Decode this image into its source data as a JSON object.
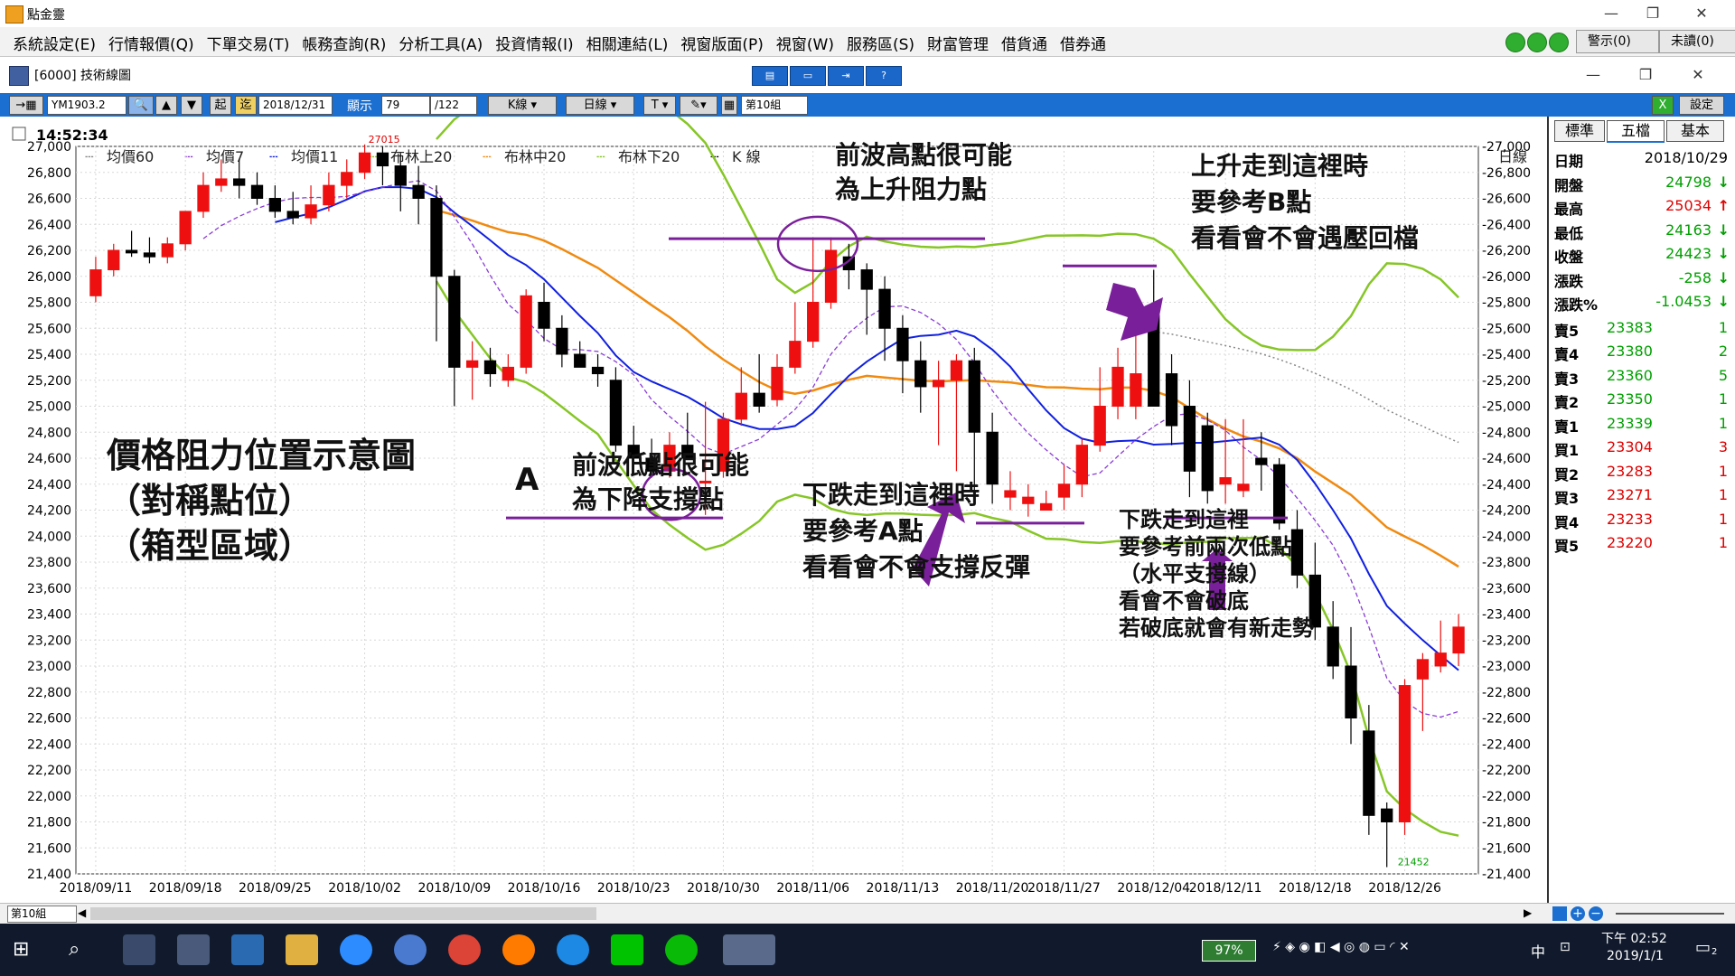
{
  "app": {
    "title": "點金靈",
    "window_controls": {
      "min": "—",
      "max": "❐",
      "close": "✕"
    }
  },
  "menu": {
    "items": [
      "系統設定(E)",
      "行情報價(Q)",
      "下單交易(T)",
      "帳務查詢(R)",
      "分析工具(A)",
      "投資情報(I)",
      "相關連結(L)",
      "視窗版面(P)",
      "視窗(W)",
      "服務區(S)",
      "財富管理",
      "借貨通",
      "借券通"
    ],
    "alert_button": "警示(0)",
    "unread_button": "未讀(0)"
  },
  "chart_window": {
    "title": "[6000] 技術線圖"
  },
  "toolbar": {
    "symbol": "YM1903.2",
    "start_btn": "起",
    "end_btn": "迄",
    "date": "2018/12/31",
    "display_label": "顯示",
    "display_count": "79",
    "total": "/122",
    "kline": "K線",
    "period": "日線",
    "text_tool": "T",
    "group": "第10組",
    "settings": "設定"
  },
  "time_display": "14:52:34",
  "legend": [
    {
      "label": "均價60",
      "color": "#888888"
    },
    {
      "label": "均價7",
      "color": "#8a3cd8"
    },
    {
      "label": "均價11",
      "color": "#1020e0"
    },
    {
      "label": "布林上20",
      "color": "#86c626"
    },
    {
      "label": "布林中20",
      "color": "#f08a10"
    },
    {
      "label": "布林下20",
      "color": "#86c626"
    },
    {
      "label": "K 線",
      "color": "#000000"
    }
  ],
  "period_label": "日線",
  "right_tabs": [
    "標準",
    "五檔",
    "基本"
  ],
  "quote": {
    "rows": [
      {
        "label": "日期",
        "value": "2018/10/29",
        "arrow": "",
        "color": "#000000"
      },
      {
        "label": "開盤",
        "value": "24798",
        "arrow": "↓",
        "color": "#00a000"
      },
      {
        "label": "最高",
        "value": "25034",
        "arrow": "↑",
        "color": "#e00000"
      },
      {
        "label": "最低",
        "value": "24163",
        "arrow": "↓",
        "color": "#00a000"
      },
      {
        "label": "收盤",
        "value": "24423",
        "arrow": "↓",
        "color": "#00a000"
      },
      {
        "label": "漲跌",
        "value": "-258",
        "arrow": "↓",
        "color": "#00a000"
      },
      {
        "label": "漲跌%",
        "value": "-1.0453",
        "arrow": "↓",
        "color": "#00a000"
      }
    ]
  },
  "order_book": [
    {
      "label": "賣5",
      "price": "23383",
      "qty": "1",
      "color": "#00a000"
    },
    {
      "label": "賣4",
      "price": "23380",
      "qty": "2",
      "color": "#00a000"
    },
    {
      "label": "賣3",
      "price": "23360",
      "qty": "5",
      "color": "#00a000"
    },
    {
      "label": "賣2",
      "price": "23350",
      "qty": "1",
      "color": "#00a000"
    },
    {
      "label": "賣1",
      "price": "23339",
      "qty": "1",
      "color": "#00a000"
    },
    {
      "label": "買1",
      "price": "23304",
      "qty": "3",
      "color": "#e00000"
    },
    {
      "label": "買2",
      "price": "23283",
      "qty": "1",
      "color": "#e00000"
    },
    {
      "label": "買3",
      "price": "23271",
      "qty": "1",
      "color": "#e00000"
    },
    {
      "label": "買4",
      "price": "23233",
      "qty": "1",
      "color": "#e00000"
    },
    {
      "label": "買5",
      "price": "23220",
      "qty": "1",
      "color": "#e00000"
    }
  ],
  "annotations": {
    "title_lines": [
      "價格阻力位置示意圖",
      "（對稱點位）",
      "（箱型區域）"
    ],
    "point_a": "A",
    "support_note": [
      "前波低點很可能",
      "為下降支撐點"
    ],
    "resistance_note": [
      "前波高點很可能",
      "為上升阻力點"
    ],
    "down_to_a": [
      "下跌走到這裡時",
      "要參考A點",
      "看看會不會支撐反彈"
    ],
    "up_to_b": [
      "上升走到這裡時",
      "要參考B點",
      "看看會不會遇壓回檔"
    ],
    "down_two_lows": [
      "下跌走到這裡",
      "要參考前兩次低點",
      "（水平支撐線）",
      "看會不會破底",
      "若破底就會有新走勢"
    ],
    "high_label": "27015",
    "low_label": "21452"
  },
  "bottom": {
    "group_select": "第10組"
  },
  "taskbar": {
    "battery": "97%",
    "ime": "中",
    "time": "下午 02:52",
    "date": "2019/1/1",
    "notif": "2"
  },
  "chart_data": {
    "type": "candlestick",
    "x": [
      "2018/09/11",
      "2018/09/12",
      "2018/09/13",
      "2018/09/14",
      "2018/09/17",
      "2018/09/18",
      "2018/09/19",
      "2018/09/20",
      "2018/09/21",
      "2018/09/24",
      "2018/09/25",
      "2018/09/26",
      "2018/09/27",
      "2018/09/28",
      "2018/10/01",
      "2018/10/02",
      "2018/10/03",
      "2018/10/04",
      "2018/10/05",
      "2018/10/08",
      "2018/10/09",
      "2018/10/10",
      "2018/10/11",
      "2018/10/12",
      "2018/10/15",
      "2018/10/16",
      "2018/10/17",
      "2018/10/18",
      "2018/10/19",
      "2018/10/22",
      "2018/10/23",
      "2018/10/24",
      "2018/10/25",
      "2018/10/26",
      "2018/10/29",
      "2018/10/30",
      "2018/10/31",
      "2018/11/01",
      "2018/11/02",
      "2018/11/05",
      "2018/11/06",
      "2018/11/07",
      "2018/11/08",
      "2018/11/09",
      "2018/11/12",
      "2018/11/13",
      "2018/11/14",
      "2018/11/15",
      "2018/11/16",
      "2018/11/19",
      "2018/11/20",
      "2018/11/21",
      "2018/11/23",
      "2018/11/26",
      "2018/11/27",
      "2018/11/28",
      "2018/11/29",
      "2018/11/30",
      "2018/12/03",
      "2018/12/04",
      "2018/12/06",
      "2018/12/07",
      "2018/12/10",
      "2018/12/11",
      "2018/12/12",
      "2018/12/13",
      "2018/12/14",
      "2018/12/17",
      "2018/12/18",
      "2018/12/19",
      "2018/12/20",
      "2018/12/21",
      "2018/12/24",
      "2018/12/26",
      "2018/12/27",
      "2018/12/28",
      "2018/12/31"
    ],
    "open": [
      25850,
      26050,
      26200,
      26180,
      26150,
      26250,
      26500,
      26700,
      26750,
      26700,
      26600,
      26500,
      26450,
      26550,
      26700,
      26800,
      26950,
      26850,
      26700,
      26600,
      26000,
      25300,
      25350,
      25200,
      25300,
      25800,
      25600,
      25400,
      25300,
      25200,
      24700,
      24600,
      24500,
      24700,
      24423,
      24500,
      24900,
      25100,
      25050,
      25300,
      25500,
      25800,
      26150,
      26050,
      25900,
      25600,
      25350,
      25150,
      25200,
      25350,
      24800,
      24300,
      24250,
      24200,
      24300,
      24400,
      24700,
      25000,
      25000,
      25700,
      25250,
      25000,
      24850,
      24400,
      24350,
      24600,
      24550,
      24050,
      23700,
      23300,
      23000,
      22500,
      21900,
      21800,
      22900,
      23000,
      23100
    ],
    "high": [
      26150,
      26250,
      26350,
      26300,
      26300,
      26500,
      26800,
      26900,
      26900,
      26800,
      26700,
      26650,
      26700,
      26800,
      26900,
      27015,
      27000,
      26950,
      26850,
      26700,
      26050,
      25500,
      25450,
      25400,
      25900,
      25950,
      25700,
      25500,
      25400,
      25300,
      24850,
      24750,
      24800,
      24950,
      25034,
      24950,
      25300,
      25400,
      25400,
      25800,
      26300,
      26300,
      26250,
      26100,
      26000,
      25700,
      25500,
      25350,
      25400,
      25450,
      24950,
      24500,
      24400,
      24350,
      24550,
      24750,
      25300,
      25450,
      25800,
      26050,
      25400,
      25200,
      24950,
      24900,
      24900,
      24800,
      24600,
      24200,
      23950,
      23500,
      23300,
      22700,
      21950,
      22900,
      23100,
      23350,
      23400
    ],
    "low": [
      25800,
      26000,
      26150,
      26100,
      26100,
      26200,
      26450,
      26650,
      26600,
      26550,
      26450,
      26400,
      26400,
      26500,
      26600,
      26750,
      26700,
      26500,
      26400,
      25500,
      25000,
      25050,
      25150,
      25150,
      25250,
      25500,
      25300,
      25300,
      25150,
      24650,
      24550,
      24450,
      24450,
      24600,
      24163,
      24450,
      24850,
      24950,
      25000,
      25250,
      25450,
      25750,
      25900,
      25550,
      25350,
      25100,
      24950,
      24700,
      24500,
      24300,
      24250,
      24200,
      24150,
      24200,
      24200,
      24300,
      24650,
      24900,
      24900,
      25000,
      24700,
      24300,
      24250,
      24250,
      24300,
      24350,
      24050,
      23600,
      23200,
      22900,
      22400,
      21700,
      21452,
      21700,
      22500,
      22950,
      23000
    ],
    "close": [
      26050,
      26200,
      26180,
      26150,
      26250,
      26500,
      26700,
      26750,
      26700,
      26600,
      26500,
      26450,
      26550,
      26700,
      26800,
      26950,
      26850,
      26700,
      26600,
      26000,
      25300,
      25350,
      25250,
      25300,
      25850,
      25600,
      25400,
      25300,
      25250,
      24700,
      24600,
      24500,
      24700,
      24600,
      24423,
      24900,
      25100,
      25000,
      25300,
      25500,
      25800,
      26200,
      26050,
      25900,
      25600,
      25350,
      25150,
      25200,
      25350,
      24800,
      24400,
      24350,
      24300,
      24250,
      24400,
      24700,
      25000,
      25300,
      25250,
      25000,
      24850,
      24500,
      24350,
      24450,
      24400,
      24550,
      24100,
      23700,
      23300,
      23000,
      22600,
      21850,
      21800,
      22850,
      23050,
      23100,
      23300
    ],
    "ylim": [
      21400,
      27000
    ],
    "yticks": [
      27000,
      26800,
      26600,
      26400,
      26200,
      26000,
      25800,
      25600,
      25400,
      25200,
      25000,
      24800,
      24600,
      24400,
      24200,
      24000,
      23800,
      23600,
      23400,
      23200,
      23000,
      22800,
      22600,
      22400,
      22200,
      22000,
      21800,
      21600,
      21400
    ],
    "xticks": [
      "2018/09/11",
      "2018/09/18",
      "2018/09/25",
      "2018/10/02",
      "2018/10/09",
      "2018/10/16",
      "2018/10/23",
      "2018/10/30",
      "2018/11/06",
      "2018/11/13",
      "2018/11/20",
      "2018/11/27",
      "2018/12/04",
      "2018/12/11",
      "2018/12/18",
      "2018/12/26"
    ],
    "grid": true
  }
}
